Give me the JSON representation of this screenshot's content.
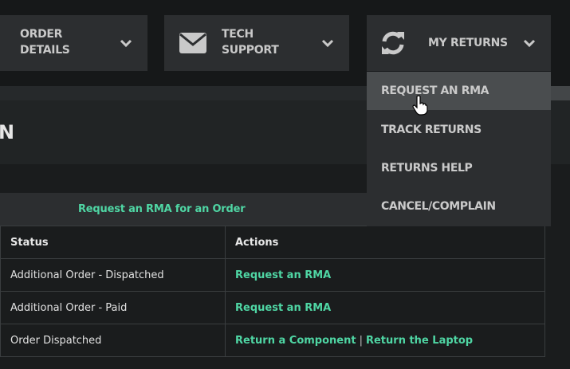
{
  "nav": {
    "items": [
      {
        "label_line1": "ORDER",
        "label_line2": "DETAILS",
        "icon": "truck-icon"
      },
      {
        "label_line1": "TECH",
        "label_line2": "SUPPORT",
        "icon": "envelope-icon"
      },
      {
        "label_line1": "MY RETURNS",
        "label_line2": "",
        "icon": "refresh-icon"
      }
    ]
  },
  "dropdown": {
    "items": [
      {
        "label": "REQUEST AN RMA",
        "hovered": true
      },
      {
        "label": "TRACK RETURNS"
      },
      {
        "label": "RETURNS HELP"
      },
      {
        "label": "CANCEL/COMPLAIN"
      }
    ]
  },
  "page": {
    "title_fragment": "N"
  },
  "rma_bar": {
    "link_label": "Request an RMA for an Order"
  },
  "table": {
    "headers": [
      "Status",
      "Actions"
    ],
    "rows": [
      {
        "status": "Additional Order - Dispatched",
        "actions": [
          "Request an RMA"
        ]
      },
      {
        "status": "Additional Order - Paid",
        "actions": [
          "Request an RMA"
        ]
      },
      {
        "status": "Order Dispatched",
        "actions": [
          "Return a Component",
          "Return the Laptop"
        ],
        "separator": "|"
      }
    ]
  },
  "colors": {
    "accent": "#4fd6a4",
    "nav_box": "#2c2e30",
    "menu_hover": "#4a4d4f",
    "background": "#1a1c1d"
  }
}
